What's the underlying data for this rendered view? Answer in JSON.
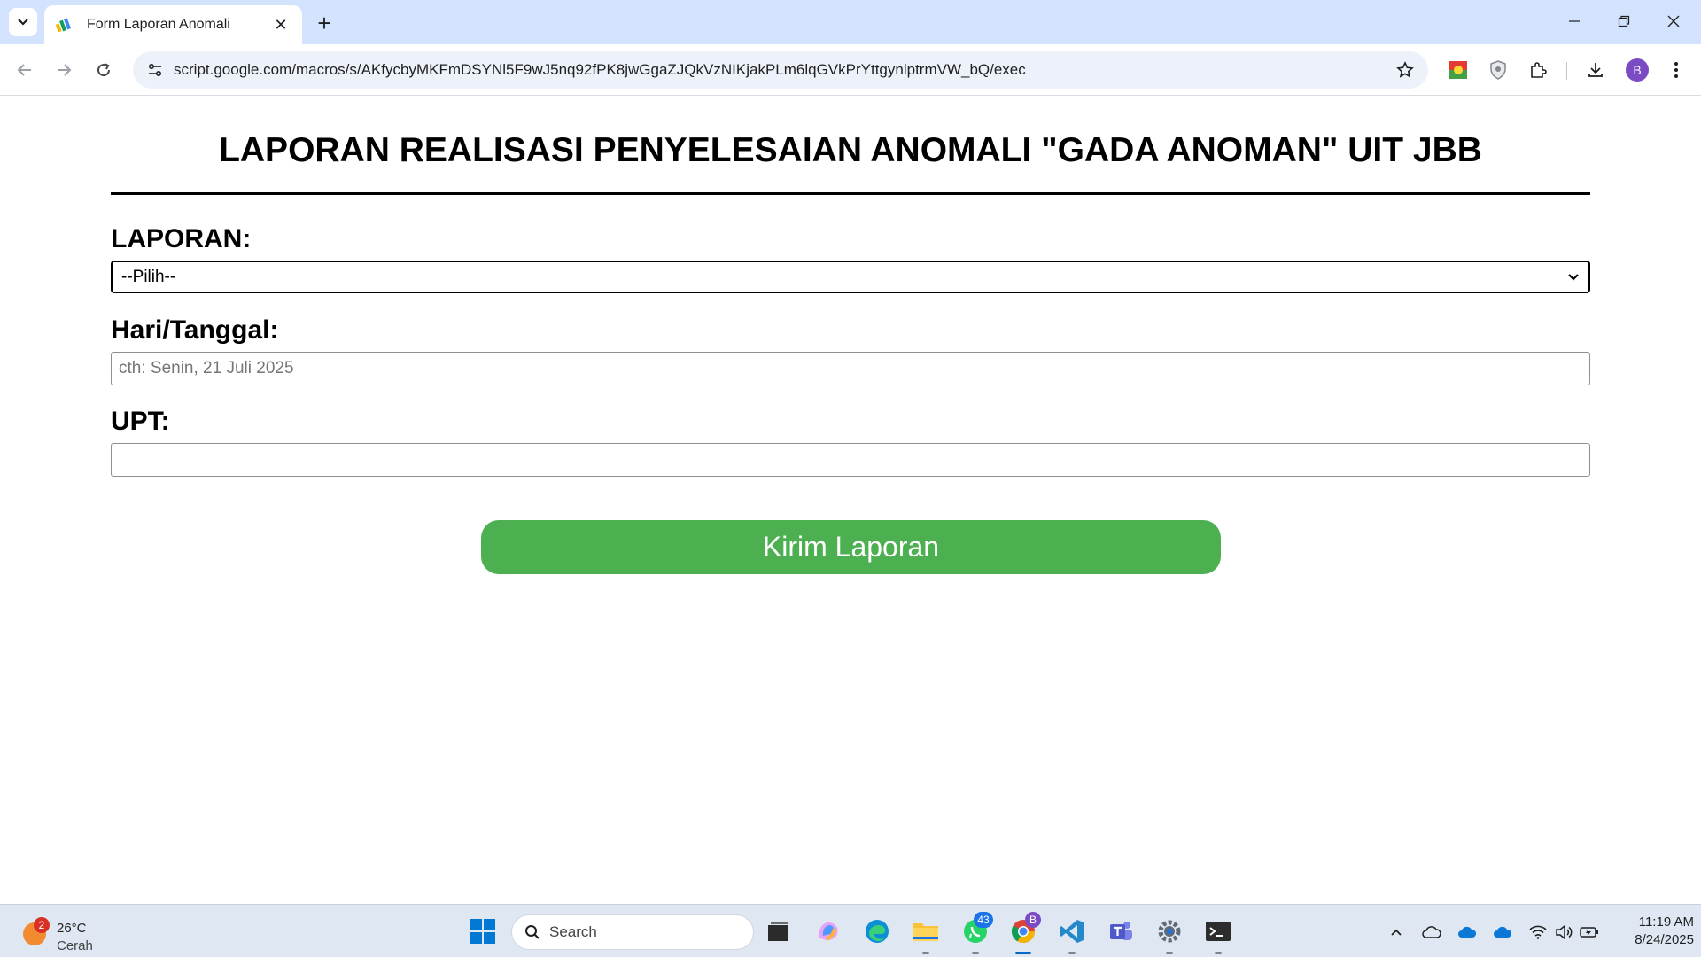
{
  "browser": {
    "tab": {
      "title": "Form Laporan Anomali",
      "close_glyph": "✕"
    },
    "new_tab_glyph": "+",
    "url": "script.google.com/macros/s/AKfycbyMKFmDSYNl5F9wJ5nq92fPK8jwGgaZJQkVzNIKjakPLm6lqGVkPrYttgynlptrmVW_bQ/exec",
    "profile_initial": "B",
    "window_controls": {
      "minimize": "—",
      "restore": "❐",
      "close": "✕"
    }
  },
  "form": {
    "title": "LAPORAN REALISASI PENYELESAIAN ANOMALI \"GADA ANOMAN\" UIT JBB",
    "laporan": {
      "label": "LAPORAN:",
      "selected": "--Pilih--"
    },
    "tanggal": {
      "label": "Hari/Tanggal:",
      "placeholder": "cth: Senin, 21 Juli 2025"
    },
    "upt": {
      "label": "UPT:",
      "placeholder": ""
    },
    "submit_label": "Kirim Laporan"
  },
  "taskbar": {
    "weather": {
      "badge": "2",
      "temp": "26°C",
      "condition": "Cerah"
    },
    "search_label": "Search",
    "whatsapp_badge": "43",
    "chrome_badge": "B",
    "clock": {
      "time": "11:19 AM",
      "date": "8/24/2025"
    }
  },
  "colors": {
    "tabstrip": "#d3e3fd",
    "submit_button": "#4caf50",
    "taskbar": "#dfe8f2"
  }
}
